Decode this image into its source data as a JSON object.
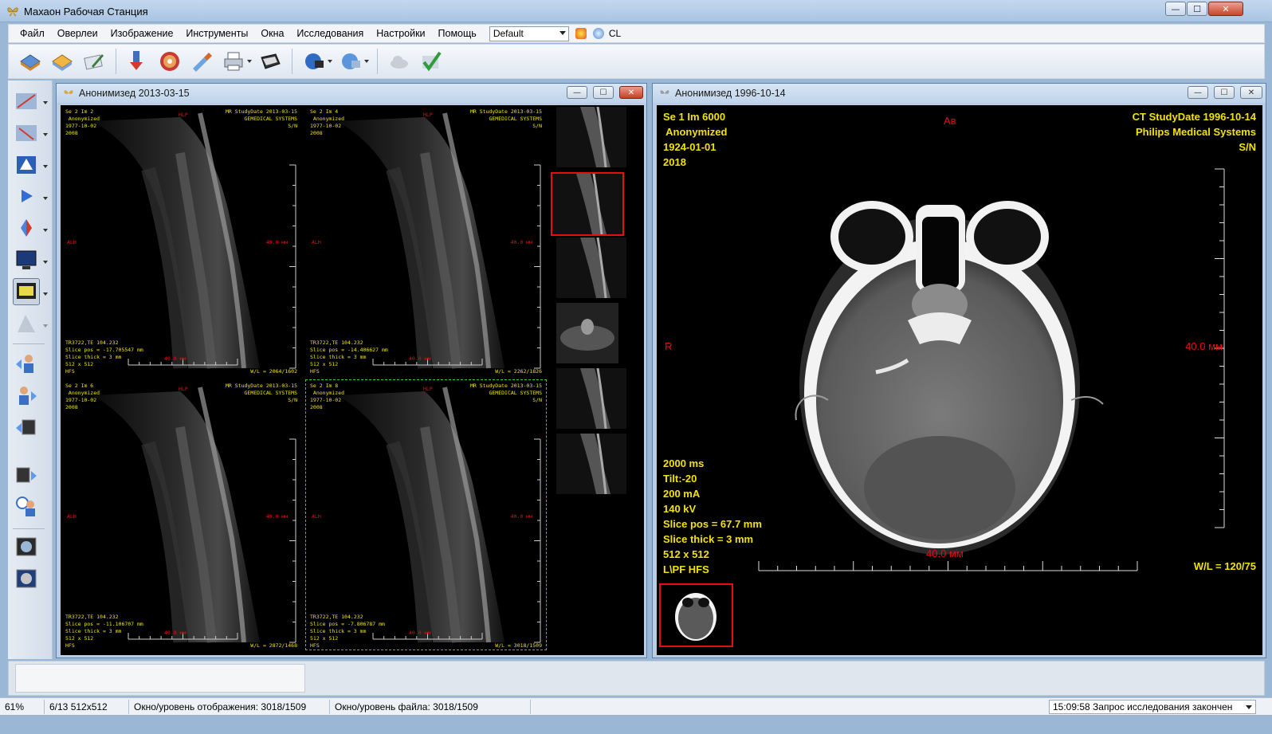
{
  "app": {
    "title": "Махаон Рабочая Станция"
  },
  "window_controls": {
    "minimize": "—",
    "maximize": "☐",
    "close": "✕"
  },
  "menu": [
    "Файл",
    "Оверлеи",
    "Изображение",
    "Инструменты",
    "Окна",
    "Исследования",
    "Настройки",
    "Помощь"
  ],
  "preset_select": {
    "value": "Default"
  },
  "menu_extra": {
    "cl_label": "CL"
  },
  "toolbar": {
    "buttons": [
      "open-study-icon",
      "open-folder-icon",
      "edit-icon",
      "download-icon",
      "cd-icon",
      "brush-icon",
      "print-icon",
      "scanner-icon",
      "network-send-icon",
      "network-receive-icon",
      "cloud-icon",
      "check-icon"
    ]
  },
  "sidebar": {
    "buttons": [
      "measure-icon",
      "arrow-annotation-icon",
      "roi-icon",
      "play-icon",
      "contrast-icon",
      "monitor-icon",
      "series-compare-icon",
      "grid-icon",
      "patient-back-icon",
      "patient-forward-icon",
      "series-swap-icon",
      "series-layout-icon",
      "patient-time-icon",
      "layout-one-icon",
      "layout-quad-icon"
    ]
  },
  "window_left": {
    "title": "Анонимизед  2013-03-15",
    "viewports": [
      {
        "tl": "Se 2 Im 2\n Anonymized\n1977-10-02\n2008",
        "tr": "MR StudyDate 2013-03-15\nGEMEDICAL SYSTEMS\nS/N",
        "top": "HLP",
        "left": "ALH",
        "right": "40.0 мм",
        "bl": "TR3722,TE 104.232\nSlice pos = -17.705547 mm\nSlice thick = 3 mm\n512 x 512\nHFS",
        "bottom": "40.0 мм",
        "br": "W/L = 2064/1602"
      },
      {
        "tl": "Se 2 Im 4\n Anonymized\n1977-10-02\n2008",
        "tr": "MR StudyDate 2013-03-15\nGEMEDICAL SYSTEMS\nS/N",
        "top": "HLP",
        "left": "ALH",
        "right": "40.0 мм",
        "bl": "TR3722,TE 104.232\nSlice pos = -14.406627 mm\nSlice thick = 3 mm\n512 x 512\nHFS",
        "bottom": "40.0 мм",
        "br": "W/L = 2262/1826"
      },
      {
        "tl": "Se 2 Im 6\n Anonymized\n1977-10-02\n2008",
        "tr": "MR StudyDate 2013-03-15\nGEMEDICAL SYSTEMS\nS/N",
        "top": "HLP",
        "left": "ALH",
        "right": "40.0 мм",
        "bl": "TR3722,TE 104.232\nSlice pos = -11.106707 mm\nSlice thick = 3 mm\n512 x 512\nHFS",
        "bottom": "40.0 мм",
        "br": "W/L = 2872/1468"
      },
      {
        "tl": "Se 2 Im 8\n Anonymized\n1977-10-02\n2008",
        "tr": "MR StudyDate 2013-03-15\nGEMEDICAL SYSTEMS\nS/N",
        "top": "HLP",
        "left": "ALH",
        "right": "40.0 мм",
        "bl": "TR3722,TE 104.232\nSlice pos = -7.806787 mm\nSlice thick = 3 mm\n512 x 512\nHFS",
        "bottom": "40.0 мм",
        "br": "W/L = 3018/1509"
      }
    ]
  },
  "window_right": {
    "title": "Анонимизед  1996-10-14",
    "tl": "Se 1 Im 6000\n Anonymized\n1924-01-01\n2018",
    "tr": "CT StudyDate 1996-10-14\nPhilips Medical Systems\nS/N",
    "top": "Aв",
    "left": "R",
    "right": "40.0 мм",
    "bl": "2000 ms\nTilt:-20\n200 mA\n140 kV\nSlice pos = 67.7 mm\nSlice thick = 3 mm\n512 x 512\nL\\PF HFS",
    "bottom": "40.0 мм",
    "br": "W/L = 120/75"
  },
  "statusbar": {
    "zoom": "61%",
    "image_info": "6/13 512x512",
    "display_wl": "Окно/уровень отображения: 3018/1509",
    "file_wl": "Окно/уровень файла: 3018/1509",
    "message": "15:09:58 Запрос исследования закончен"
  },
  "colors": {
    "overlay_text": "#f2e20c",
    "overlay_red": "#e41010",
    "selection": "#e41010",
    "active_dashed": "#2ecf3a"
  }
}
